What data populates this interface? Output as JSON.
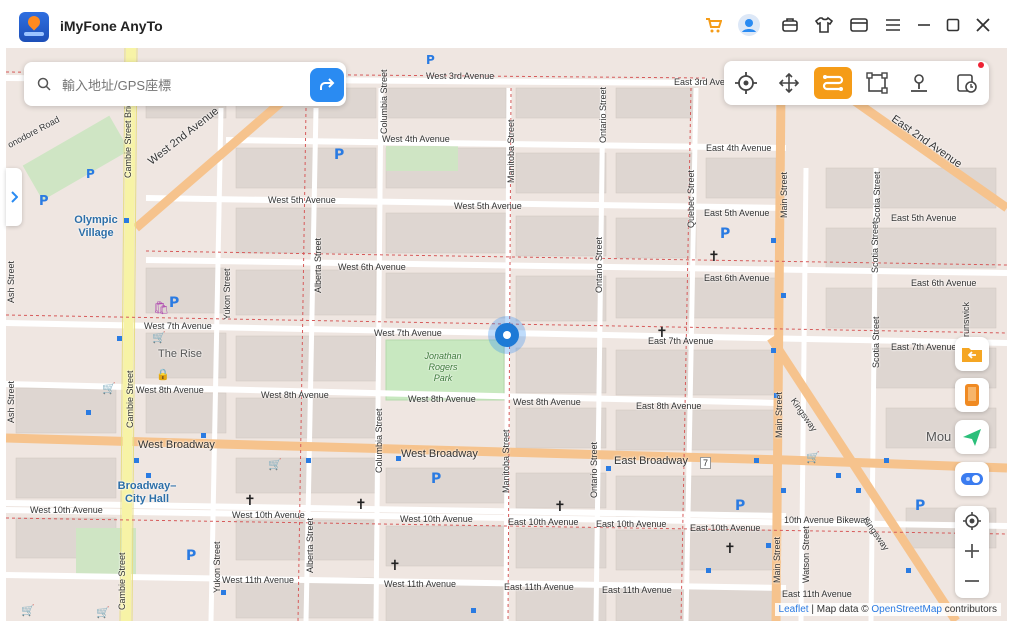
{
  "app": {
    "title": "iMyFone AnyTo"
  },
  "search": {
    "placeholder": "輸入地址/GPS座標"
  },
  "toolbar": {
    "tools": [
      "crosshair-icon",
      "move-arrows-icon",
      "route-icon",
      "multi-stop-icon",
      "person-pin-icon",
      "history-icon"
    ],
    "active": "route-icon"
  },
  "map": {
    "streets": {
      "w3": "West 3rd Avenue",
      "e3": "East 3rd Avenue",
      "w4": "West 4th Avenue",
      "e4": "East 4th Avenue",
      "w5a": "West 5th Avenue",
      "w5b": "West 5th Avenue",
      "e5": "East 5th Avenue",
      "e5b": "East 5th Avenue",
      "w6": "West 6th Avenue",
      "e6": "East 6th Avenue",
      "e6b": "East 6th Avenue",
      "w7": "West 7th Avenue",
      "w7b": "West 7th Avenue",
      "e7": "East 7th Avenue",
      "e7b": "East 7th Avenue",
      "w8": "West 8th Avenue",
      "w8b": "West 8th Avenue",
      "w8c": "West 8th Avenue",
      "w8d": "West 8th Avenue",
      "e8": "East 8th Avenue",
      "wb": "West Broadway",
      "wb2": "West Broadway",
      "eb": "East Broadway",
      "w10": "West 10th Avenue",
      "w10b": "West 10th Avenue",
      "w10c": "West 10th Avenue",
      "e10": "East 10th Avenue",
      "e10b": "East 10th Avenue",
      "e10c": "East 10th Avenue",
      "e10bike": "10th Avenue Bikeway",
      "w11": "West 11th Avenue",
      "w11b": "West 11th Avenue",
      "e11": "East 11th Avenue",
      "e11b": "East 11th Avenue",
      "e11c": "East 11th Avenue",
      "e2": "East 2nd Avenue",
      "w2": "West 2nd Avenue",
      "cambie": "Cambie Street",
      "cambie2": "Cambie Street",
      "cambieBridge": "Cambie Street Bridge",
      "yukon": "Yukon Street",
      "yukon2": "Yukon Street",
      "alberta": "Alberta Street",
      "alberta2": "Alberta Street",
      "columbia": "Columbia Street",
      "columbia2": "Columbia Street",
      "manitoba": "Manitoba Street",
      "manitoba2": "Manitoba Street",
      "ontario": "Ontario Street",
      "ontario2": "Ontario Street",
      "ontario3": "Ontario Street",
      "quebec": "Quebec Street",
      "main": "Main Street",
      "main2": "Main Street",
      "main3": "Main Street",
      "scotia": "Scotia Street",
      "scotia2": "Scotia Street",
      "scotia3": "Scotia Street",
      "watson": "Watson Street",
      "kingsway": "Kingsway",
      "kingsway2": "Kingsway",
      "ash": "Ash Street",
      "ash2": "Ash Street",
      "onodore": "onodore Road",
      "brunswick": "Brunswick",
      "route7": "7"
    },
    "places": {
      "olympic": "Olympic Village",
      "therise": "The Rise",
      "jrp": "Jonathan Rogers Park",
      "broadway_city_hall": "Broadway–City Hall",
      "mou": "Mou"
    }
  },
  "attribution": {
    "leaflet": "Leaflet",
    "sep": " | Map data © ",
    "osm": "OpenStreetMap",
    "rest": " contributors"
  }
}
